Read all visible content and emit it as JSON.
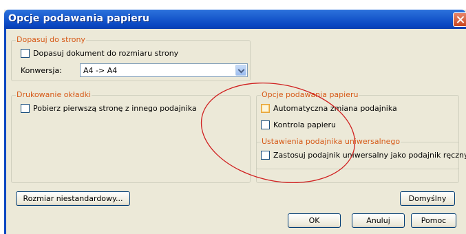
{
  "window": {
    "title": "Opcje podawania papieru"
  },
  "fit_group": {
    "legend": "Dopasuj do strony",
    "fit_checkbox_label": "Dopasuj dokument do rozmiaru strony",
    "conversion_label": "Konwersja:",
    "conversion_value": "A4 -> A4"
  },
  "cover_group": {
    "legend": "Drukowanie okładki",
    "checkbox_label": "Pobierz pierwszą stronę z innego podajnika"
  },
  "feed_group": {
    "legend": "Opcje podawania papieru",
    "auto_tray_label": "Automatyczna zmiana podajnika",
    "paper_check_label": "Kontrola papieru"
  },
  "universal_group": {
    "legend": "Ustawienia podajnika uniwersalnego",
    "checkbox_label": "Zastosuj podajnik uniwersalny jako podajnik ręczny"
  },
  "buttons": {
    "custom_size": "Rozmiar niestandardowy...",
    "defaults": "Domyślny",
    "ok": "OK",
    "cancel": "Anuluj",
    "help": "Pomoc"
  },
  "colors": {
    "title_bar": "#0a47c2",
    "legend_text": "#d65a18",
    "annotation_ellipse": "#d02020",
    "dialog_bg": "#ece9d8"
  }
}
